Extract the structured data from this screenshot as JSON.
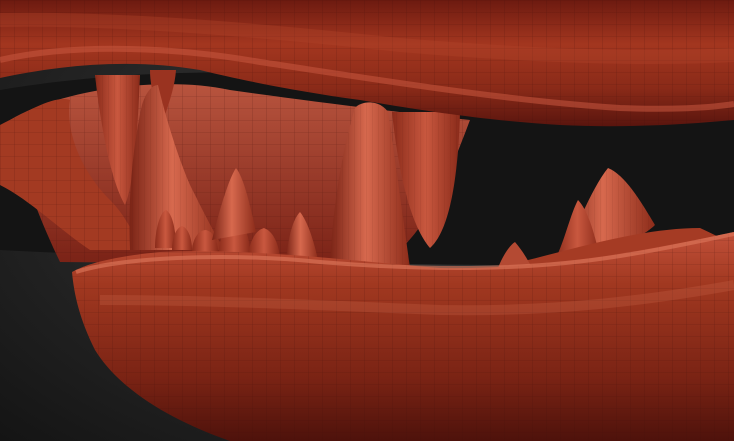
{
  "viewport": {
    "subject": "sculpted-jaw-model",
    "colors": {
      "background": "#262626",
      "clay_dark": "#5a150e",
      "clay_mid": "#8f2c1d",
      "clay_light": "#c8573f",
      "clay_highlight": "#e07a5e",
      "inner_mouth": "#7a2216",
      "wire": "#3d0e08"
    }
  }
}
